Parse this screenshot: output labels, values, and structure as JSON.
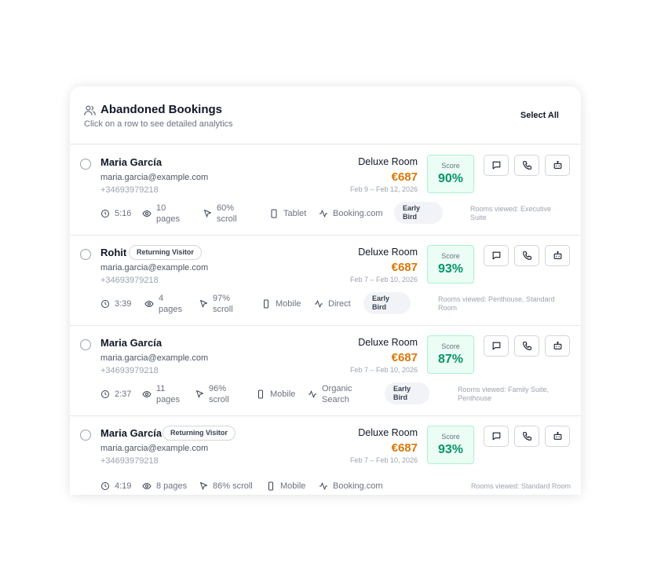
{
  "header": {
    "icon": "users-icon",
    "title": "Abandoned Bookings",
    "subtitle": "Click on a row to see detailed analytics",
    "select_all": "Select All"
  },
  "score_label": "Score",
  "colors": {
    "price": "#d97706",
    "score_text": "#059669",
    "score_bg": "#ecfdf5",
    "score_border": "#a7f3d0"
  },
  "actions": [
    "message-icon",
    "phone-icon",
    "bot-icon"
  ],
  "bookings": [
    {
      "name": "Maria García",
      "visitor_badge": "",
      "email": "maria.garcia@example.com",
      "phone": "+34693979218",
      "room": "Deluxe Room",
      "price": "€687",
      "dates": "Feb 9 – Feb 12, 2026",
      "score": "90%",
      "time": "5:16",
      "pages": "10 pages",
      "scroll": "60% scroll",
      "device": "Tablet",
      "source": "Booking.com",
      "tag": "Early Bird",
      "rooms_viewed": "Rooms viewed: Executive Suite"
    },
    {
      "name": "Rohit",
      "visitor_badge": "Returning Visitor",
      "email": "maria.garcia@example.com",
      "phone": "+34693979218",
      "room": "Deluxe Room",
      "price": "€687",
      "dates": "Feb 7 – Feb 10, 2026",
      "score": "93%",
      "time": "3:39",
      "pages": "4 pages",
      "scroll": "97% scroll",
      "device": "Mobile",
      "source": "Direct",
      "tag": "Early Bird",
      "rooms_viewed": "Rooms viewed: Penthouse, Standard Room"
    },
    {
      "name": "Maria García",
      "visitor_badge": "",
      "email": "maria.garcia@example.com",
      "phone": "+34693979218",
      "room": "Deluxe Room",
      "price": "€687",
      "dates": "Feb 7 – Feb 10, 2026",
      "score": "87%",
      "time": "2:37",
      "pages": "11 pages",
      "scroll": "96% scroll",
      "device": "Mobile",
      "source": "Organic Search",
      "tag": "Early Bird",
      "rooms_viewed": "Rooms viewed: Family Suite, Penthouse"
    },
    {
      "name": "Maria García",
      "visitor_badge": "Returning Visitor",
      "email": "maria.garcia@example.com",
      "phone": "+34693979218",
      "room": "Deluxe Room",
      "price": "€687",
      "dates": "Feb 7 – Feb 10, 2026",
      "score": "93%",
      "time": "4:19",
      "pages": "8 pages",
      "scroll": "86% scroll",
      "device": "Mobile",
      "source": "Booking.com",
      "tag": "",
      "rooms_viewed": "Rooms viewed: Standard Room"
    }
  ]
}
